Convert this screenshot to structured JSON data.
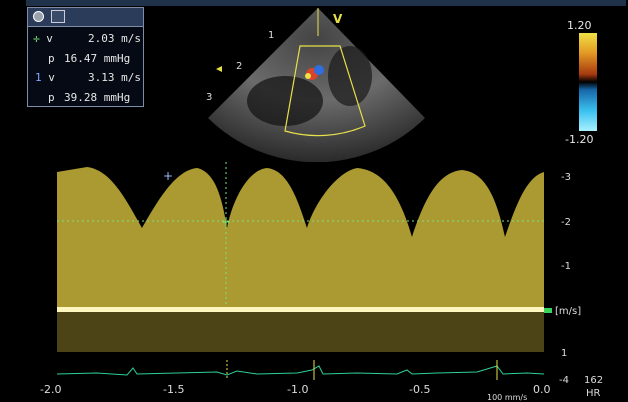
{
  "measurements": [
    {
      "marker": "+",
      "label": "v",
      "value": "2.03",
      "unit": "m/s",
      "color": "#7be37b"
    },
    {
      "marker": "",
      "label": "p",
      "value": "16.47",
      "unit": "mmHg"
    },
    {
      "marker": "1",
      "label": "v",
      "value": "3.13",
      "unit": "m/s",
      "color": "#7fa7ff"
    },
    {
      "marker": "",
      "label": "p",
      "value": "39.28",
      "unit": "mmHg"
    }
  ],
  "sector": {
    "apex_label": "V",
    "depth_marks": [
      "1",
      "2",
      "3"
    ]
  },
  "colorbar": {
    "top": "1.20",
    "bottom": "-1.20"
  },
  "velocity_scale": {
    "ticks": [
      "-3",
      "-2",
      "-1",
      "[m/s]",
      "1"
    ],
    "unit": "[m/s]"
  },
  "time_axis": {
    "ticks": [
      "-2.0",
      "-1.5",
      "-1.0",
      "-0.5",
      "0.0"
    ],
    "sweep": "100 mm/s"
  },
  "heart_rate": {
    "value": "162",
    "label": "HR",
    "depth": "-4"
  }
}
